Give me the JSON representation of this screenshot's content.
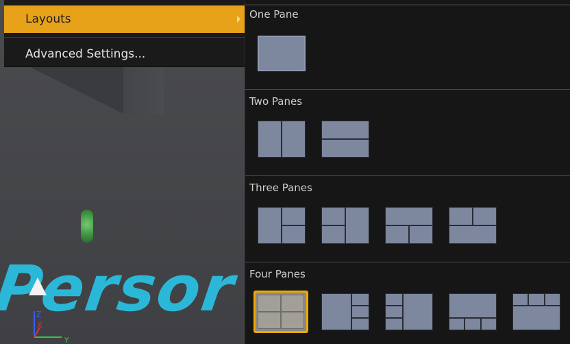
{
  "menu": {
    "items": [
      {
        "label": "Layouts",
        "active": true,
        "has_submenu": true
      },
      {
        "label": "Advanced Settings...",
        "active": false,
        "has_submenu": false
      }
    ],
    "accent_color": "#e8a21a"
  },
  "layouts": {
    "sections": [
      {
        "label": "One Pane",
        "options": [
          {
            "icon": "one-pane-icon",
            "selected": false
          }
        ]
      },
      {
        "label": "Two Panes",
        "options": [
          {
            "icon": "two-panes-vertical-icon",
            "selected": false
          },
          {
            "icon": "two-panes-horizontal-icon",
            "selected": false
          }
        ]
      },
      {
        "label": "Three Panes",
        "options": [
          {
            "icon": "three-panes-left-big-icon",
            "selected": false
          },
          {
            "icon": "three-panes-right-big-icon",
            "selected": false
          },
          {
            "icon": "three-panes-top-big-icon",
            "selected": false
          },
          {
            "icon": "three-panes-bottom-big-icon",
            "selected": false
          }
        ]
      },
      {
        "label": "Four Panes",
        "options": [
          {
            "icon": "four-panes-grid-icon",
            "selected": true
          },
          {
            "icon": "four-panes-left-big-icon",
            "selected": false
          },
          {
            "icon": "four-panes-right-big-icon",
            "selected": false
          },
          {
            "icon": "four-panes-top-big-icon",
            "selected": false
          },
          {
            "icon": "four-panes-bottom-big-icon",
            "selected": false
          }
        ]
      }
    ]
  },
  "viewport": {
    "overlay_text": "Persor",
    "axis_labels": {
      "z": "Z",
      "x": "X",
      "y": "Y"
    }
  }
}
